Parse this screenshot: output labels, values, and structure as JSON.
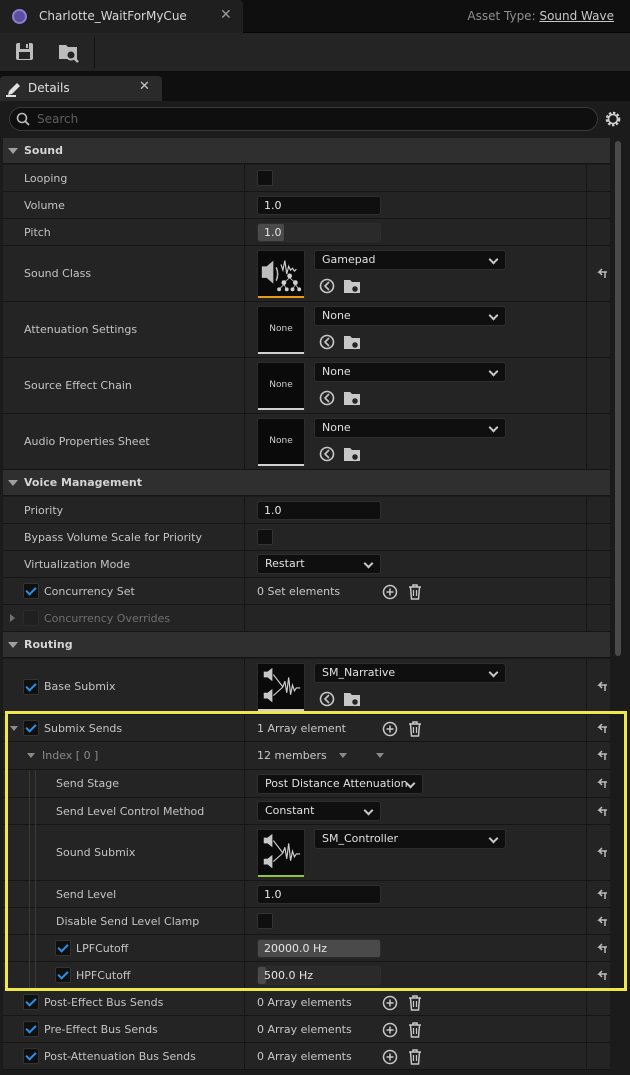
{
  "window": {
    "tab_title": "Charlotte_WaitForMyCue",
    "asset_type_label": "Asset Type:",
    "asset_type_value": "Sound Wave"
  },
  "panel": {
    "tab_label": "Details",
    "search_placeholder": "Search"
  },
  "categories": {
    "sound": "Sound",
    "voice": "Voice Management",
    "routing": "Routing"
  },
  "sound": {
    "looping": {
      "label": "Looping",
      "checked": false
    },
    "volume": {
      "label": "Volume",
      "value": "1.0"
    },
    "pitch": {
      "label": "Pitch",
      "value": "1.0"
    },
    "sound_class": {
      "label": "Sound Class",
      "value": "Gamepad"
    },
    "attenuation": {
      "label": "Attenuation Settings",
      "value": "None",
      "thumb": "None"
    },
    "source_effect": {
      "label": "Source Effect Chain",
      "value": "None",
      "thumb": "None"
    },
    "audio_props": {
      "label": "Audio Properties Sheet",
      "value": "None",
      "thumb": "None"
    }
  },
  "voice": {
    "priority": {
      "label": "Priority",
      "value": "1.0"
    },
    "bypass": {
      "label": "Bypass Volume Scale for Priority",
      "checked": false
    },
    "virtualization": {
      "label": "Virtualization Mode",
      "value": "Restart"
    },
    "concurrency_set": {
      "label": "Concurrency Set",
      "value": "0 Set elements",
      "checked": true
    },
    "concurrency_overrides": {
      "label": "Concurrency Overrides",
      "checked": false
    }
  },
  "routing": {
    "base_submix": {
      "label": "Base Submix",
      "value": "SM_Narrative",
      "checked": true
    },
    "submix_sends": {
      "label": "Submix Sends",
      "value": "1 Array element",
      "checked": true
    },
    "index0": {
      "label": "Index [ 0 ]",
      "value": "12 members"
    },
    "send_stage": {
      "label": "Send Stage",
      "value": "Post Distance Attenuation"
    },
    "send_level_method": {
      "label": "Send Level Control Method",
      "value": "Constant"
    },
    "sound_submix": {
      "label": "Sound Submix",
      "value": "SM_Controller"
    },
    "send_level": {
      "label": "Send Level",
      "value": "1.0"
    },
    "disable_clamp": {
      "label": "Disable Send Level Clamp",
      "checked": false
    },
    "lpf": {
      "label": "LPFCutoff",
      "value": "20000.0 Hz",
      "checked": true
    },
    "hpf": {
      "label": "HPFCutoff",
      "value": "500.0 Hz",
      "checked": true
    },
    "post_effect_bus": {
      "label": "Post-Effect Bus Sends",
      "value": "0 Array elements",
      "checked": true
    },
    "pre_effect_bus": {
      "label": "Pre-Effect Bus Sends",
      "value": "0 Array elements",
      "checked": true
    },
    "post_atten_bus": {
      "label": "Post-Attenuation Bus Sends",
      "value": "0 Array elements",
      "checked": true
    }
  },
  "colors": {
    "accent_blue": "#2d8fe8",
    "sound_class_bar": "#e89a1a",
    "submix_bar": "#8ec63f",
    "highlight": "#f0e84a"
  }
}
